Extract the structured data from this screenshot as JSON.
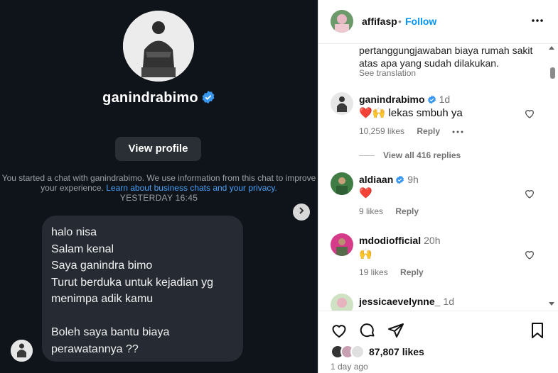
{
  "dm": {
    "profile_name": "ganindrabimo",
    "view_profile_label": "View profile",
    "notice_text": "You started a chat with ganindrabimo. We use information from this chat to improve your experience.",
    "notice_link": "Learn about business chats and your privacy.",
    "timestamp": "YESTERDAY 16:45",
    "message": "halo nisa\nSalam kenal\nSaya ganindra bimo\nTurut berduka untuk kejadian yg menimpa adik kamu\n\nBoleh saya bantu biaya perawatannya ??"
  },
  "post": {
    "author": "affifasp",
    "dot": "•",
    "follow_label": "Follow",
    "caption_line1": "pertanggungjawaban biaya rumah sakit",
    "caption_line2": "atas apa yang sudah dilakukan.",
    "see_translation": "See translation",
    "comments": [
      {
        "user": "ganindrabimo",
        "time": "1d",
        "text": "❤️🙌 lekas smbuh ya",
        "likes": "10,259 likes",
        "reply": "Reply",
        "view_replies": "View all 416 replies"
      },
      {
        "user": "aldiaan",
        "time": "9h",
        "text": "❤️",
        "likes": "9 likes",
        "reply": "Reply"
      },
      {
        "user": "mdodiofficial",
        "time": "20h",
        "text": "🙌",
        "likes": "19 likes",
        "reply": "Reply"
      },
      {
        "user": "jessicaevelynne_",
        "time": "1d"
      }
    ],
    "likes_count": "87,807 likes",
    "date": "1 day ago"
  },
  "colors": {
    "dm_bg": "#0f141a",
    "bubble_bg": "#262b33",
    "accent_blue": "#0095f6",
    "verified_blue": "#3897f0"
  }
}
